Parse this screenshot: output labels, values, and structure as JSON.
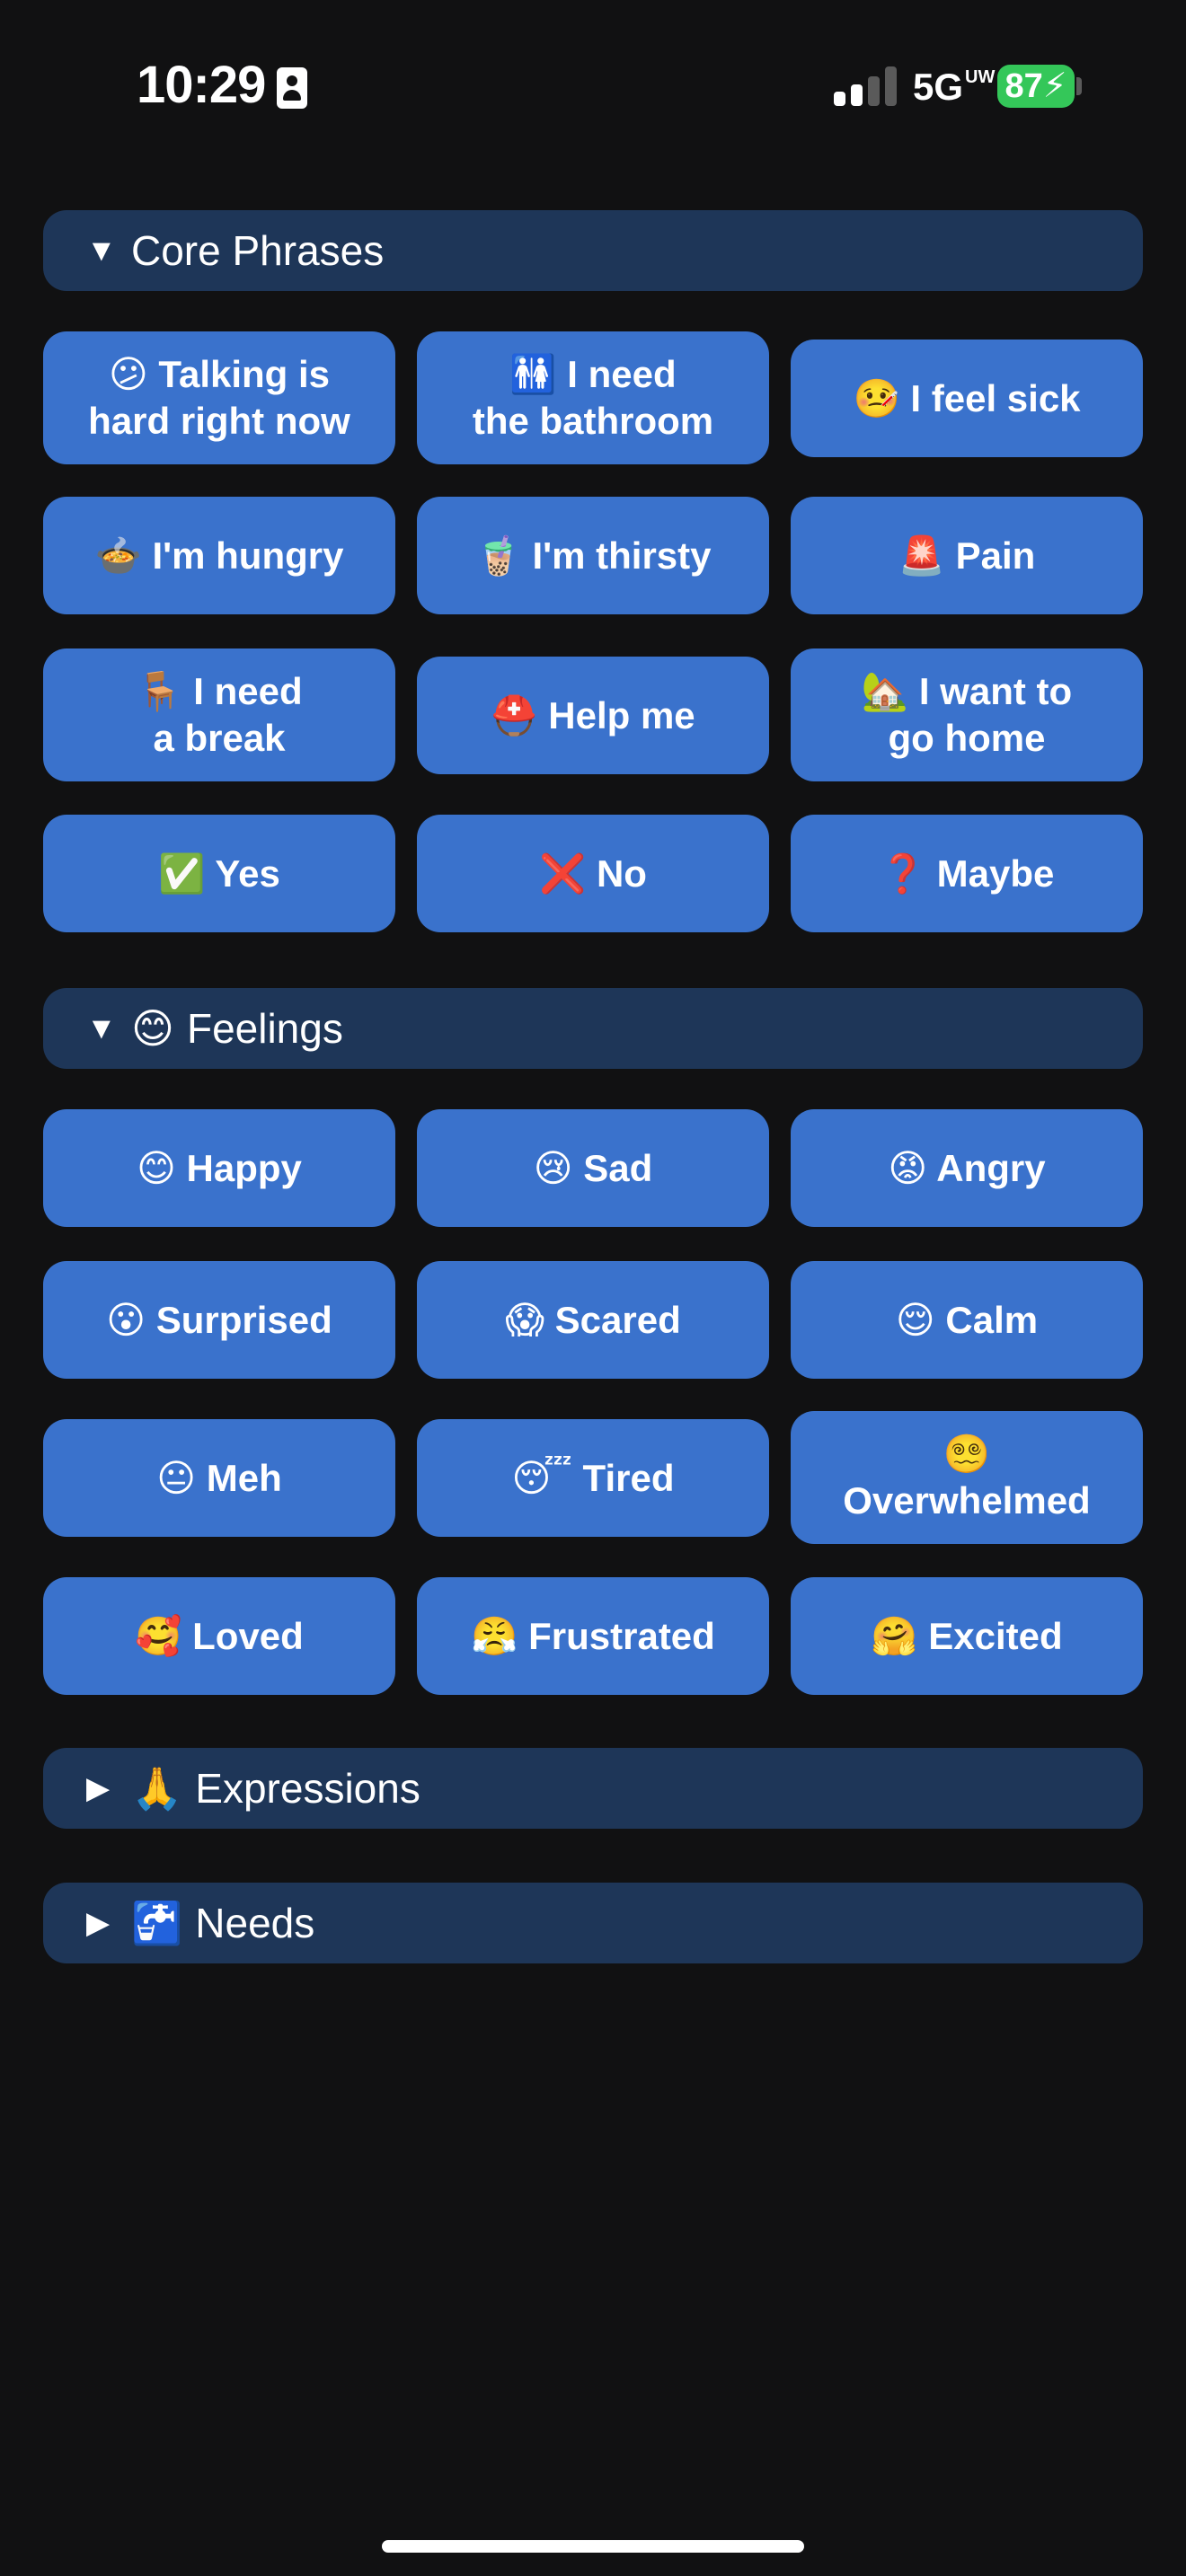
{
  "status_bar": {
    "time": "10:29",
    "network": "5G",
    "network_sup": "UW",
    "battery": "87",
    "colors": {
      "battery": "#34c759",
      "signal_active": "#ffffff",
      "signal_inactive": "#5a5a5a"
    },
    "signal_bars_active": 2,
    "signal_bars_total": 4
  },
  "sections": {
    "core": {
      "title": "Core Phrases",
      "arrow": "▼",
      "expanded": true,
      "buttons": [
        "😕 Talking is\nhard right now",
        "🚻 I need\nthe bathroom",
        "🤒 I feel sick",
        "🍲 I'm hungry",
        "🧋 I'm thirsty",
        "🚨 Pain",
        "🪑 I need\na break",
        "⛑️ Help me",
        "🏡 I want to\ngo home",
        "✅ Yes",
        "❌ No",
        "❓ Maybe"
      ]
    },
    "feelings": {
      "title": "Feelings",
      "emoji": "😊",
      "arrow": "▼",
      "expanded": true,
      "buttons": [
        "😊 Happy",
        "😢 Sad",
        "😡 Angry",
        "😮 Surprised",
        "😱 Scared",
        "😌 Calm",
        "😐 Meh",
        "😴 Tired",
        "😵‍💫\nOverwhelmed",
        "🥰 Loved",
        "😤 Frustrated",
        "🤗 Excited"
      ]
    },
    "expressions": {
      "title": "Expressions",
      "emoji": "🙏",
      "arrow": "▶",
      "expanded": false
    },
    "needs": {
      "title": "Needs",
      "emoji": "🚰",
      "arrow": "▶",
      "expanded": false
    }
  },
  "colors": {
    "background": "#111112",
    "section_header": "#1e3658",
    "button": "#3a72cc",
    "text": "#ffffff"
  }
}
